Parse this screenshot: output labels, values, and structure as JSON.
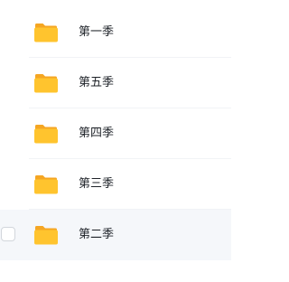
{
  "file_list": {
    "items": [
      {
        "name": "第一季",
        "icon": "folder-icon",
        "checkbox_visible": false
      },
      {
        "name": "第五季",
        "icon": "folder-icon",
        "checkbox_visible": false
      },
      {
        "name": "第四季",
        "icon": "folder-icon",
        "checkbox_visible": false
      },
      {
        "name": "第三季",
        "icon": "folder-icon",
        "checkbox_visible": false
      },
      {
        "name": "第二季",
        "icon": "folder-icon",
        "checkbox_visible": true,
        "hovered": true
      }
    ]
  },
  "colors": {
    "folder_body": "#ffc42e",
    "folder_back": "#f5a623",
    "hover_background": "#f5f7fa",
    "text": "#1f2329"
  }
}
